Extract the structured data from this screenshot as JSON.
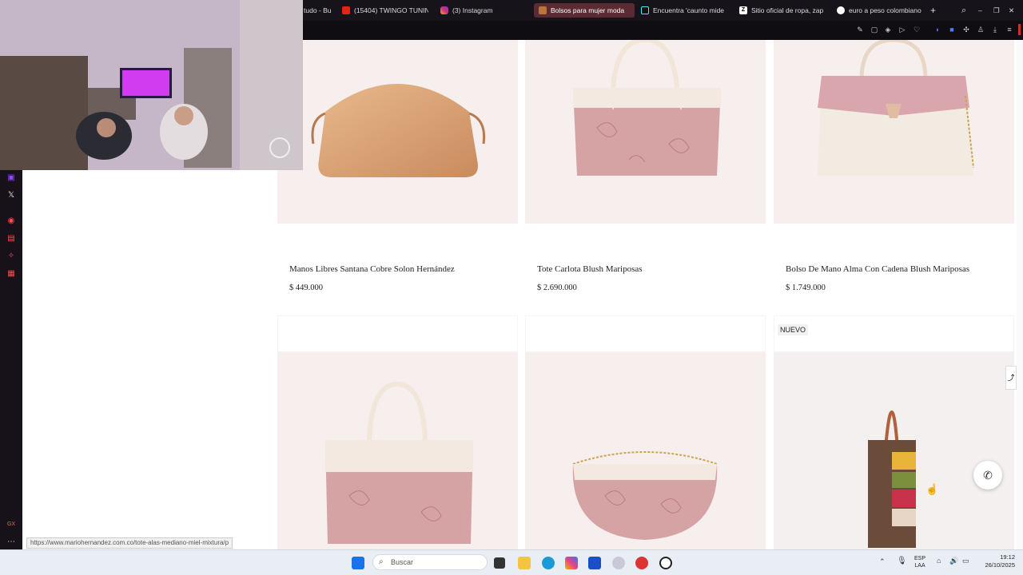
{
  "browser": {
    "tabs": [
      {
        "label": "tudo - Bu",
        "icon": "generic-icon"
      },
      {
        "label": "(15404) TWINGO TUNIN",
        "icon": "youtube-icon"
      },
      {
        "label": "(3) Instagram",
        "icon": "instagram-icon"
      },
      {
        "label": "Bolsos para mujer moda",
        "icon": "mario-hernandez-icon"
      },
      {
        "label": "Encuentra 'caunto mide",
        "icon": "tiktok-icon"
      },
      {
        "label": "Sitio oficial de ropa, zap",
        "icon": "zara-icon"
      },
      {
        "label": "euro a peso colombiano",
        "icon": "google-icon"
      }
    ],
    "new_tab": "+",
    "status_url": "https://www.mariohernandez.com.co/tote-alas-mediano-miel-mixtura/p"
  },
  "products": [
    {
      "name": "Manos Libres Santana Cobre Solon Hernández",
      "price": "$ 449.000",
      "badge": ""
    },
    {
      "name": "Tote Carlota Blush Mariposas",
      "price": "$ 2.690.000",
      "badge": ""
    },
    {
      "name": "Bolso De Mano Alma Con Cadena Blush Mariposas",
      "price": "$ 1.749.000",
      "badge": ""
    },
    {
      "name": "",
      "price": "",
      "badge": ""
    },
    {
      "name": "",
      "price": "",
      "badge": ""
    },
    {
      "name": "",
      "price": "",
      "badge": "NUEVO"
    }
  ],
  "taskbar": {
    "search_placeholder": "Buscar",
    "lang_top": "ESP",
    "lang_bottom": "LAA",
    "time": "19:12",
    "date": "26/10/2025"
  },
  "sidebar": {
    "gx_label": "GX"
  },
  "colors": {
    "accent": "#c8322f",
    "active_tab": "#5a2b32",
    "card_bg": "#f7eeee"
  }
}
